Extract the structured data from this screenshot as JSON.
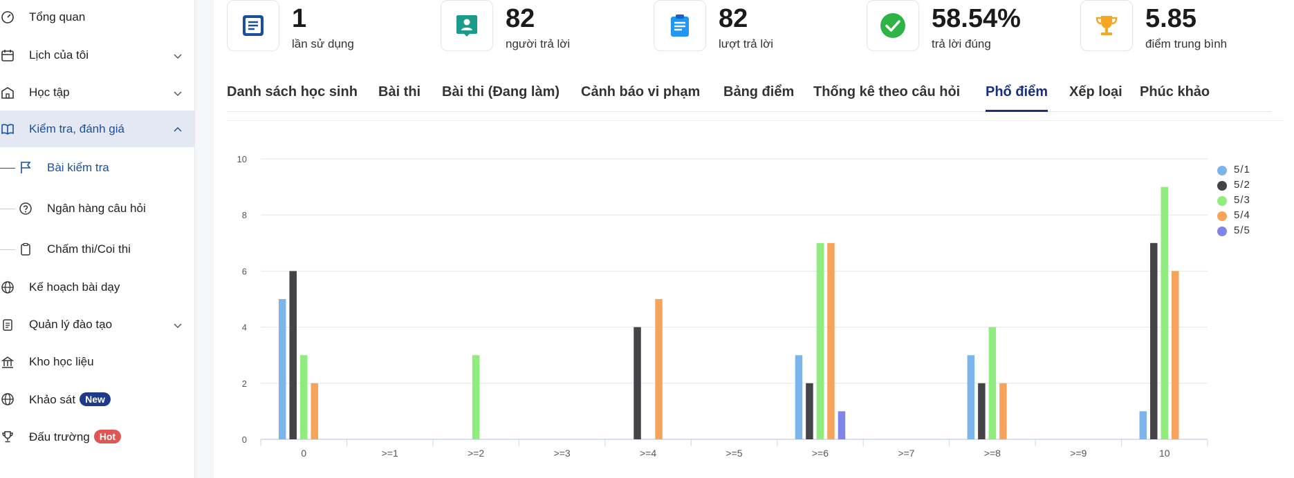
{
  "sidebar": {
    "items": [
      {
        "label": "Tổng quan",
        "icon": "dashboard-icon",
        "chevron": ""
      },
      {
        "label": "Lịch của tôi",
        "icon": "calendar-icon",
        "chevron": "down"
      },
      {
        "label": "Học tập",
        "icon": "school-icon",
        "chevron": "down"
      },
      {
        "label": "Kiểm tra, đánh giá",
        "icon": "book-icon",
        "chevron": "up"
      },
      {
        "label": "Kế hoạch bài dạy",
        "icon": "globe-icon",
        "chevron": ""
      },
      {
        "label": "Quản lý đào tạo",
        "icon": "clipboard-icon",
        "chevron": "down"
      },
      {
        "label": "Kho học liệu",
        "icon": "library-icon",
        "chevron": ""
      },
      {
        "label": "Khảo sát",
        "icon": "globe-icon",
        "badge": "New"
      },
      {
        "label": "Đấu trường",
        "icon": "trophy-icon",
        "badge": "Hot"
      }
    ],
    "subitems": [
      {
        "label": "Bài kiểm tra",
        "icon": "flag-icon"
      },
      {
        "label": "Ngân hàng câu hỏi",
        "icon": "question-icon"
      },
      {
        "label": "Chấm thi/Coi thi",
        "icon": "clipboard-icon"
      }
    ]
  },
  "stats": [
    {
      "value": "1",
      "caption": "lần sử dụng",
      "icon": "document-icon",
      "color": "#1a4fa0"
    },
    {
      "value": "82",
      "caption": "người trả lời",
      "icon": "contact-icon",
      "color": "#1b9b8a"
    },
    {
      "value": "82",
      "caption": "lượt trả lời",
      "icon": "clipboard-list-icon",
      "color": "#2196f3"
    },
    {
      "value": "58.54%",
      "caption": "trả lời đúng",
      "icon": "check-circle-icon",
      "color": "#2fb344"
    },
    {
      "value": "5.85",
      "caption": "điểm trung bình",
      "icon": "trophy-icon",
      "color": "#f5a623"
    }
  ],
  "tabs": [
    "Danh sách học sinh",
    "Bài thi",
    "Bài thi (Đang làm)",
    "Cảnh báo vi phạm",
    "Bảng điểm",
    "Thống kê theo câu hỏi",
    "Phổ điểm",
    "Xếp loại",
    "Phúc khảo"
  ],
  "active_tab": "Phổ điểm",
  "chart_data": {
    "type": "bar",
    "categories": [
      "0",
      ">=1",
      ">=2",
      ">=3",
      ">=4",
      ">=5",
      ">=6",
      ">=7",
      ">=8",
      ">=9",
      "10"
    ],
    "series": [
      {
        "name": "5/1",
        "color": "#7cb5ec",
        "values": [
          5,
          0,
          0,
          0,
          0,
          0,
          3,
          0,
          3,
          0,
          1
        ]
      },
      {
        "name": "5/2",
        "color": "#434348",
        "values": [
          6,
          0,
          0,
          0,
          4,
          0,
          2,
          0,
          2,
          0,
          7
        ]
      },
      {
        "name": "5/3",
        "color": "#90ed7d",
        "values": [
          3,
          0,
          3,
          0,
          0,
          0,
          7,
          0,
          4,
          0,
          9
        ]
      },
      {
        "name": "5/4",
        "color": "#f7a35c",
        "values": [
          2,
          0,
          0,
          0,
          5,
          0,
          7,
          0,
          2,
          0,
          6
        ]
      },
      {
        "name": "5/5",
        "color": "#8085e9",
        "values": [
          0,
          0,
          0,
          0,
          0,
          0,
          1,
          0,
          0,
          0,
          0
        ]
      }
    ],
    "yticks": [
      "0",
      "2",
      "4",
      "6",
      "8",
      "10"
    ],
    "ylim": [
      0,
      10
    ],
    "grid": true,
    "legend_position": "right"
  }
}
